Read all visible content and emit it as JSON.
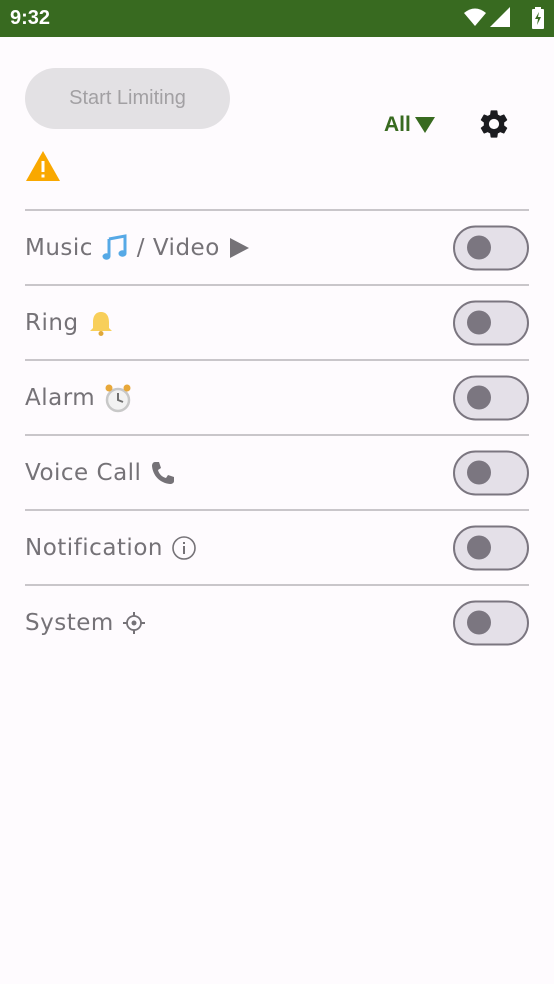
{
  "status_bar": {
    "time": "9:32",
    "icons": [
      "wifi-icon",
      "signal-icon",
      "battery-icon"
    ]
  },
  "header": {
    "start_button_label": "Start Limiting",
    "filter_label": "All",
    "filter_icon": "triangle-down-icon",
    "settings_icon": "gear-icon",
    "warning_icon": "warning-icon"
  },
  "streams": [
    {
      "label": "Music",
      "suffix": " / Video",
      "emoji": "music-note-icon",
      "emoji2": "play-icon",
      "enabled": false
    },
    {
      "label": "Ring",
      "emoji": "bell-icon",
      "enabled": false
    },
    {
      "label": "Alarm",
      "emoji": "alarm-clock-icon",
      "enabled": false
    },
    {
      "label": "Voice Call",
      "emoji": "phone-icon",
      "enabled": false
    },
    {
      "label": "Notification",
      "emoji": "info-icon",
      "enabled": false
    },
    {
      "label": "System",
      "emoji": "system-gear-icon",
      "enabled": false
    }
  ],
  "colors": {
    "accent": "#386a20",
    "warning": "#f9a800",
    "toggle_off_track": "#e4e0e8",
    "toggle_off_outline": "#7b7680"
  }
}
